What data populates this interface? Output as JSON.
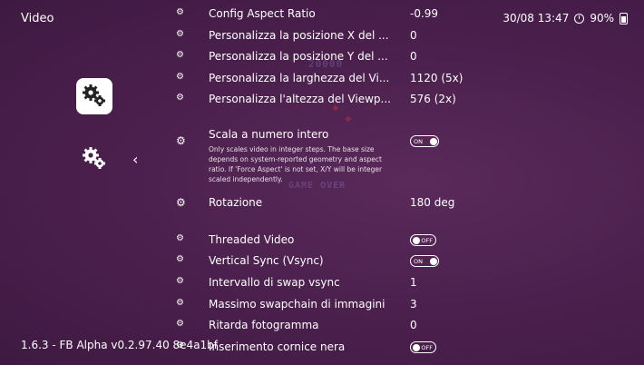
{
  "header": {
    "title": "Video"
  },
  "status": {
    "datetime": "30/08 13:47",
    "battery": "90%"
  },
  "sidebar": {
    "selected_icon": "settings-gears-icon",
    "secondary_icon": "settings-gears-icon",
    "back_icon": "chevron-left-icon"
  },
  "footer": {
    "version": "1.6.3 - FB Alpha v0.2.97.40 8e4a1bf"
  },
  "background": {
    "score": "20000",
    "game_over": "GAME OVER"
  },
  "settings": [
    {
      "label": "Config Aspect Ratio",
      "value": "-0.99"
    },
    {
      "label": "Personalizza la posizione X del ...",
      "value": "0"
    },
    {
      "label": "Personalizza la posizione Y del ...",
      "value": "0"
    },
    {
      "label": "Personalizza la larghezza del Vi...",
      "value": "1120 (5x)"
    },
    {
      "label": "Personalizza l'altezza del Viewp...",
      "value": "576 (2x)"
    },
    {
      "label": "Scala a numero intero",
      "toggle": "ON",
      "description": "Only scales video in integer steps. The base size depends on system-reported geometry and aspect ratio. If 'Force Aspect' is not set, X/Y will be integer scaled independently."
    },
    {
      "label": "Rotazione",
      "value": "180 deg"
    },
    {
      "label": "Threaded Video",
      "toggle": "OFF"
    },
    {
      "label": "Vertical Sync (Vsync)",
      "toggle": "ON"
    },
    {
      "label": "Intervallo di swap vsync",
      "value": "1"
    },
    {
      "label": "Massimo swapchain di immagini",
      "value": "3"
    },
    {
      "label": "Ritarda fotogramma",
      "value": "0"
    },
    {
      "label": "Inserimento cornice nera",
      "toggle": "OFF"
    }
  ]
}
